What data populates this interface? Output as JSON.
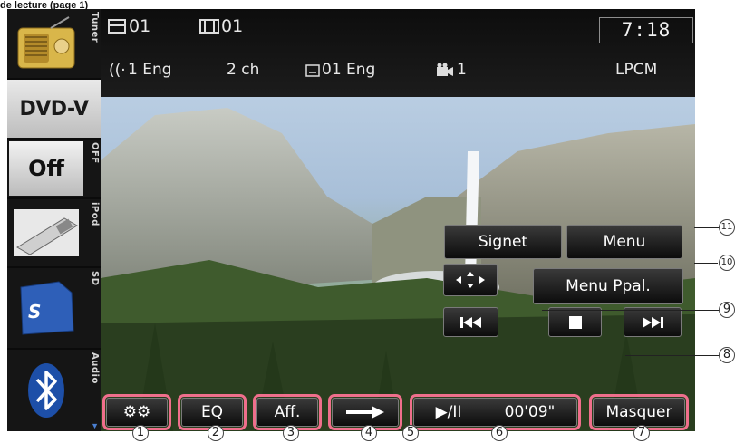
{
  "page_title": "de lecture (page 1)",
  "sidebar": {
    "sources": [
      {
        "id": "tuner",
        "label": "Tuner"
      },
      {
        "id": "dvd",
        "label": "DVD-V"
      },
      {
        "id": "off",
        "label": "OFF",
        "big": "Off"
      },
      {
        "id": "ipod",
        "label": "iPod"
      },
      {
        "id": "sd",
        "label": "SD"
      },
      {
        "id": "audio",
        "label": "Audio"
      }
    ]
  },
  "status": {
    "title_no": "01",
    "chapter_no": "01",
    "time": "7:18",
    "audio_lang": "1 Eng",
    "channels": "2 ch",
    "subtitle": "01 Eng",
    "angle": "1",
    "audio_format": "LPCM"
  },
  "buttons": {
    "signet": "Signet",
    "menu": "Menu",
    "menu_ppal": "Menu Ppal.",
    "eq": "EQ",
    "aff": "Aff.",
    "play_pause": "▶/II",
    "elapsed": "00'09\"",
    "masquer": "Masquer"
  },
  "callouts": [
    "1",
    "2",
    "3",
    "4",
    "5",
    "6",
    "7",
    "8",
    "9",
    "10",
    "11"
  ]
}
